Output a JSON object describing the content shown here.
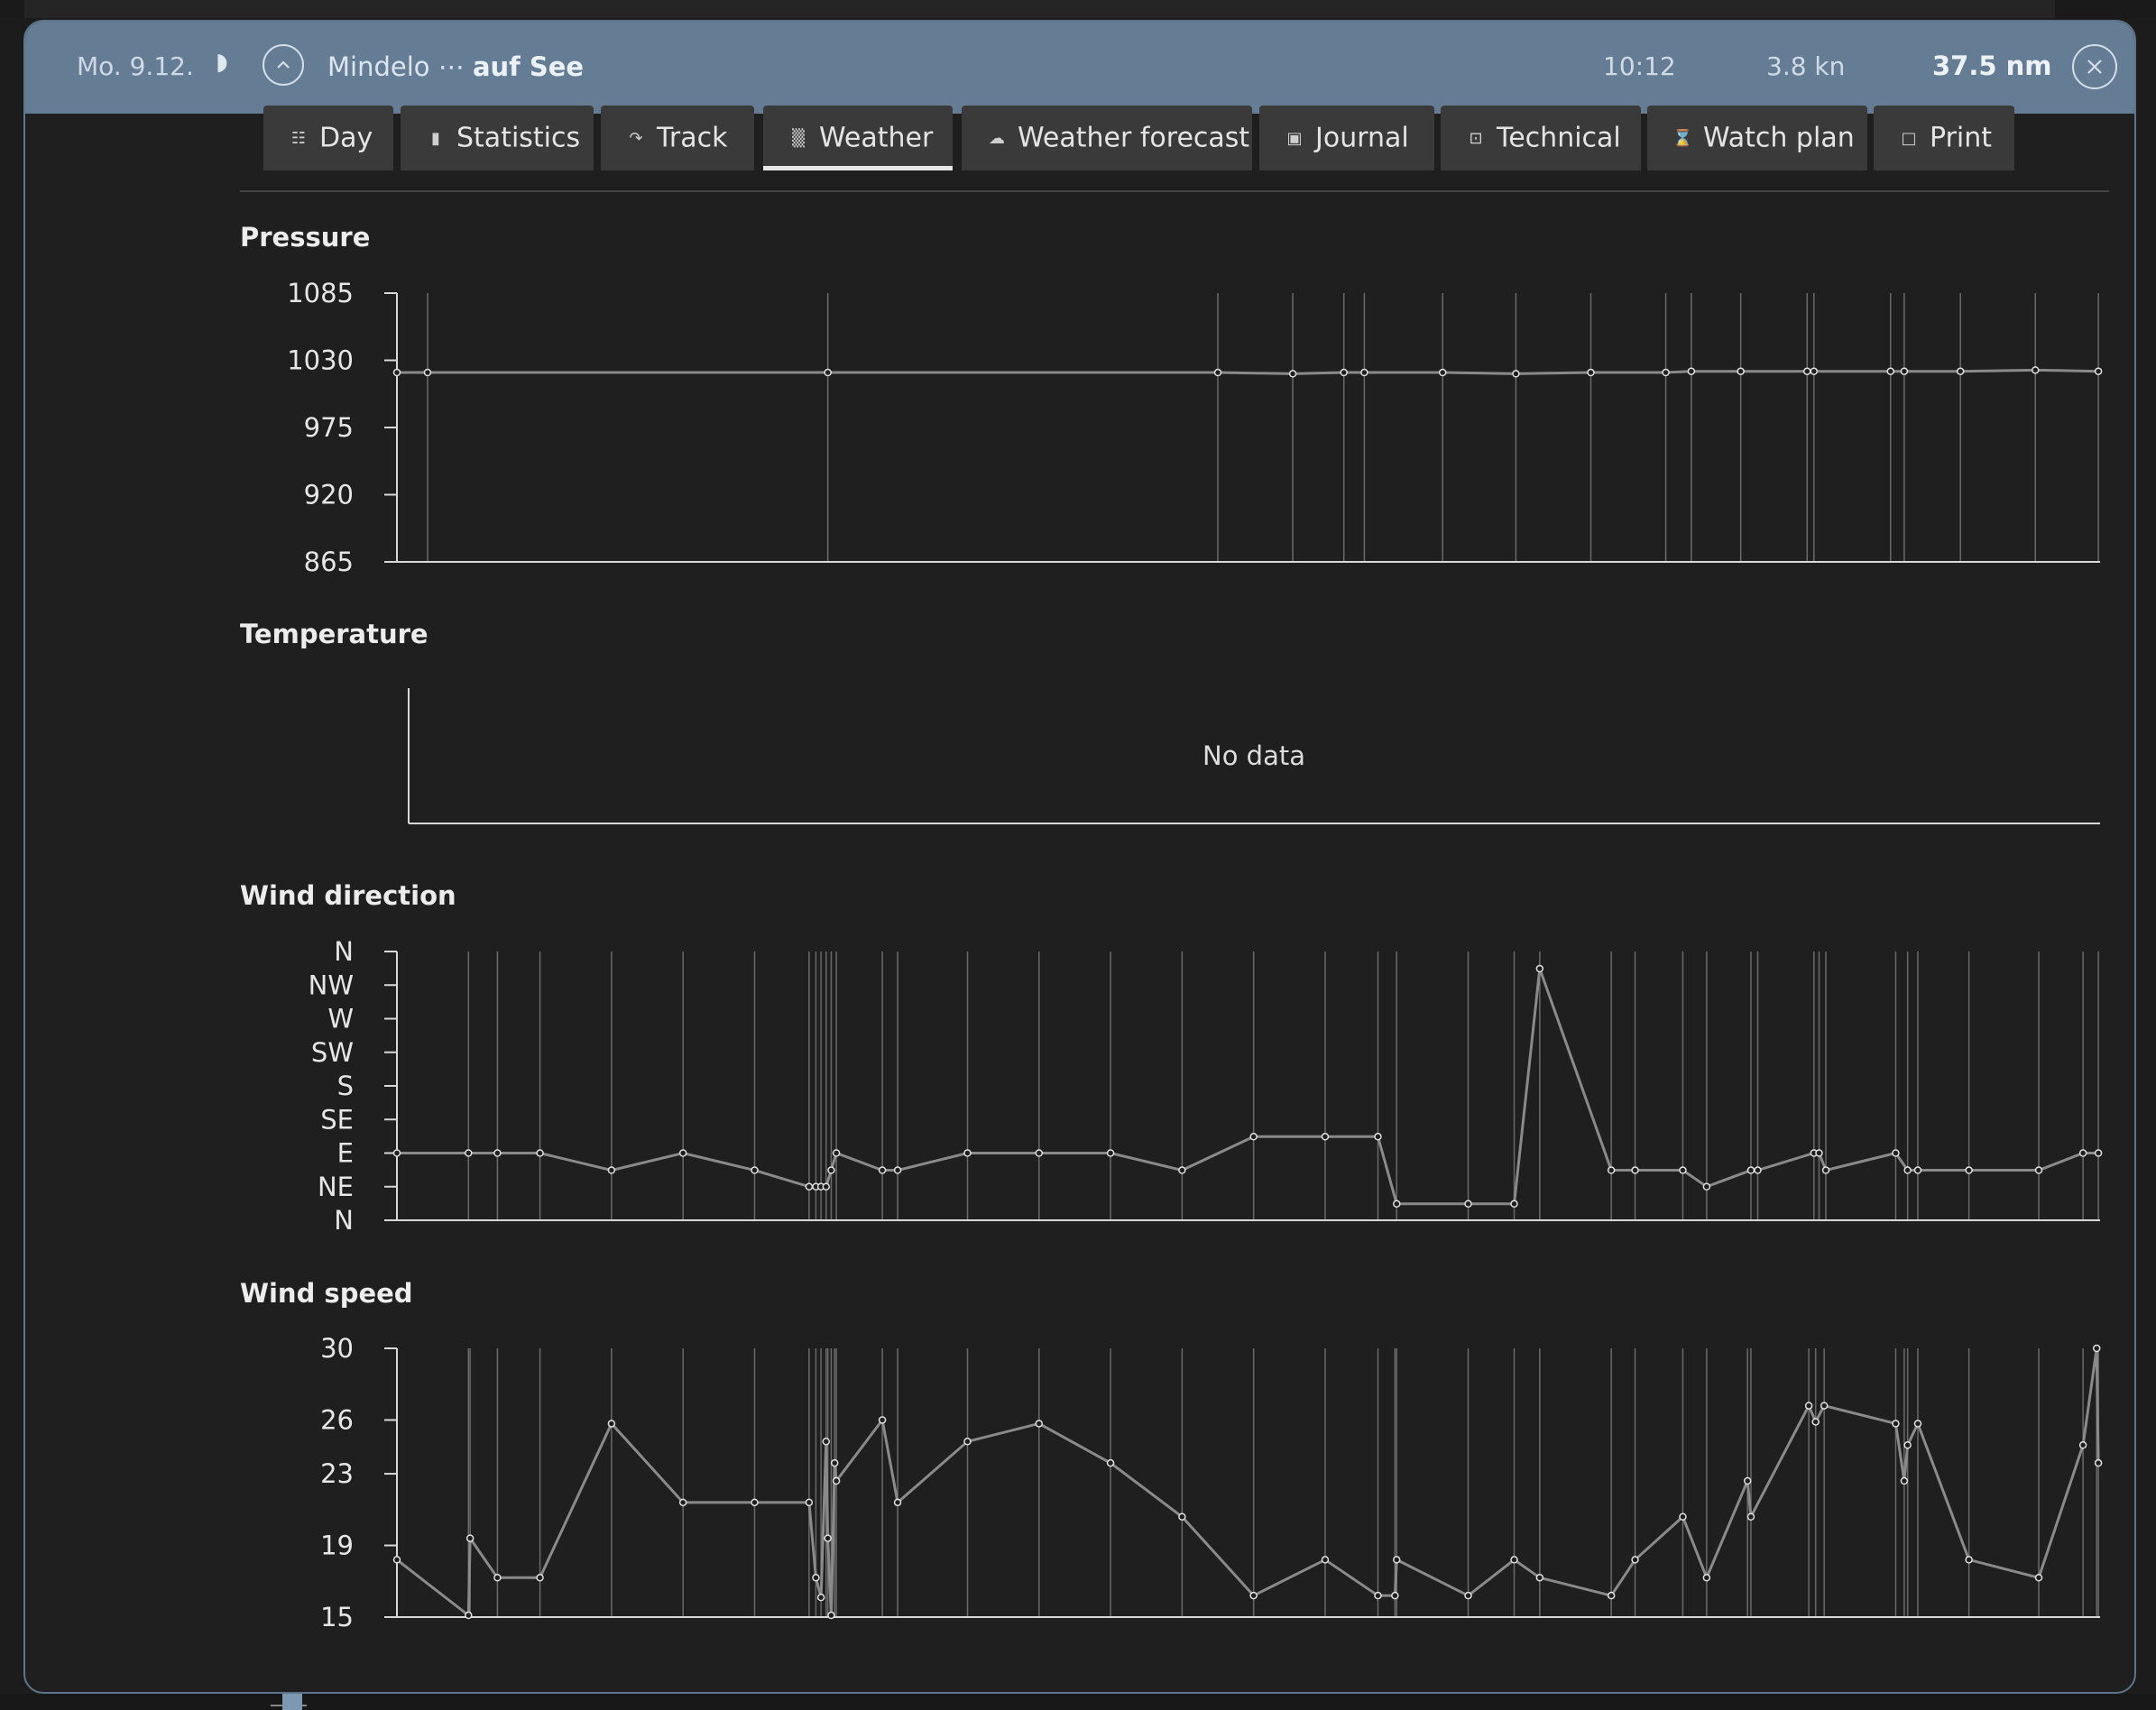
{
  "header": {
    "date": "Mo. 9.12.",
    "place_from": "Mindelo ⋯",
    "place_to": "auf See",
    "time": "10:12",
    "speed": "3.8 kn",
    "distance": "37.5 nm"
  },
  "tabs": [
    {
      "label": "Day",
      "icon": "calendar-icon",
      "active": false
    },
    {
      "label": "Statistics",
      "icon": "bar-chart-icon",
      "active": false
    },
    {
      "label": "Track",
      "icon": "track-icon",
      "active": false
    },
    {
      "label": "Weather",
      "icon": "weather-chart-icon",
      "active": true
    },
    {
      "label": "Weather forecast",
      "icon": "cloud-icon",
      "active": false
    },
    {
      "label": "Journal",
      "icon": "journal-icon",
      "active": false
    },
    {
      "label": "Technical",
      "icon": "technical-icon",
      "active": false
    },
    {
      "label": "Watch plan",
      "icon": "hourglass-icon",
      "active": false
    },
    {
      "label": "Print",
      "icon": "print-icon",
      "active": false
    }
  ],
  "sections": {
    "pressure": "Pressure",
    "temperature": "Temperature",
    "wind_direction": "Wind direction",
    "wind_speed": "Wind speed"
  },
  "colors": {
    "header": "#647d95",
    "background": "#1f1f1f",
    "tab": "#3a3a3a",
    "line": "#8a8a8a"
  },
  "chart_data": [
    {
      "id": "pressure",
      "type": "line",
      "title": "Pressure",
      "ylim": [
        865,
        1085
      ],
      "yticks": [
        1085,
        1030,
        975,
        920,
        865
      ],
      "ytick_labels": [
        "1085",
        "1030",
        "975",
        "920",
        "865"
      ],
      "x": [
        0.0,
        0.018,
        0.253,
        0.482,
        0.526,
        0.556,
        0.568,
        0.614,
        0.657,
        0.701,
        0.745,
        0.76,
        0.789,
        0.828,
        0.832,
        0.877,
        0.885,
        0.918,
        0.962,
        0.999
      ],
      "values": [
        1020,
        1020,
        1020,
        1020,
        1019,
        1020,
        1020,
        1020,
        1019,
        1020,
        1020,
        1021,
        1021,
        1021,
        1021,
        1021,
        1021,
        1021,
        1022,
        1021
      ],
      "grid": true
    },
    {
      "id": "temperature",
      "type": "line",
      "title": "Temperature",
      "empty_text": "No data"
    },
    {
      "id": "wind_direction",
      "type": "line",
      "title": "Wind direction",
      "ylim": [
        0,
        360
      ],
      "ytick_labels": [
        "N",
        "NW",
        "W",
        "SW",
        "S",
        "SE",
        "E",
        "NE",
        "N"
      ],
      "yticks": [
        360,
        315,
        270,
        225,
        180,
        135,
        90,
        45,
        0
      ],
      "x": [
        0.0,
        0.042,
        0.059,
        0.084,
        0.126,
        0.168,
        0.21,
        0.242,
        0.246,
        0.249,
        0.252,
        0.255,
        0.258,
        0.285,
        0.294,
        0.335,
        0.377,
        0.419,
        0.461,
        0.503,
        0.545,
        0.576,
        0.587,
        0.629,
        0.656,
        0.671,
        0.713,
        0.727,
        0.755,
        0.769,
        0.795,
        0.799,
        0.832,
        0.835,
        0.839,
        0.88,
        0.887,
        0.893,
        0.923,
        0.964,
        0.99,
        0.999
      ],
      "values": [
        90,
        90,
        90,
        90,
        67,
        90,
        67,
        45,
        45,
        45,
        45,
        67,
        90,
        67,
        67,
        90,
        90,
        90,
        67,
        112,
        112,
        112,
        22,
        22,
        22,
        337,
        67,
        67,
        67,
        45,
        67,
        67,
        90,
        90,
        67,
        90,
        67,
        67,
        67,
        67,
        90,
        90
      ],
      "grid": true
    },
    {
      "id": "wind_speed",
      "type": "line",
      "title": "Wind speed",
      "ylim": [
        15,
        30
      ],
      "yticks": [
        30,
        26,
        23,
        19,
        15
      ],
      "ytick_labels": [
        "30",
        "26",
        "23",
        "19",
        "15"
      ],
      "x": [
        0.0,
        0.042,
        0.043,
        0.059,
        0.084,
        0.126,
        0.168,
        0.21,
        0.242,
        0.246,
        0.249,
        0.252,
        0.253,
        0.255,
        0.257,
        0.258,
        0.285,
        0.294,
        0.335,
        0.377,
        0.419,
        0.461,
        0.503,
        0.545,
        0.576,
        0.586,
        0.587,
        0.629,
        0.656,
        0.671,
        0.713,
        0.727,
        0.755,
        0.769,
        0.793,
        0.795,
        0.829,
        0.833,
        0.838,
        0.88,
        0.885,
        0.887,
        0.893,
        0.923,
        0.964,
        0.99,
        0.998,
        0.999
      ],
      "values": [
        18.2,
        15.1,
        19.4,
        17.2,
        17.2,
        25.8,
        21.4,
        21.4,
        21.4,
        17.2,
        16.1,
        24.8,
        19.4,
        15.1,
        23.6,
        22.6,
        26.0,
        21.4,
        24.8,
        25.8,
        23.6,
        20.6,
        16.2,
        18.2,
        16.2,
        16.2,
        18.2,
        16.2,
        18.2,
        17.2,
        16.2,
        18.2,
        20.6,
        17.2,
        22.6,
        20.6,
        26.8,
        25.9,
        26.8,
        25.8,
        22.6,
        24.6,
        25.8,
        18.2,
        17.2,
        24.6,
        30.0,
        23.6
      ],
      "grid": true
    }
  ]
}
